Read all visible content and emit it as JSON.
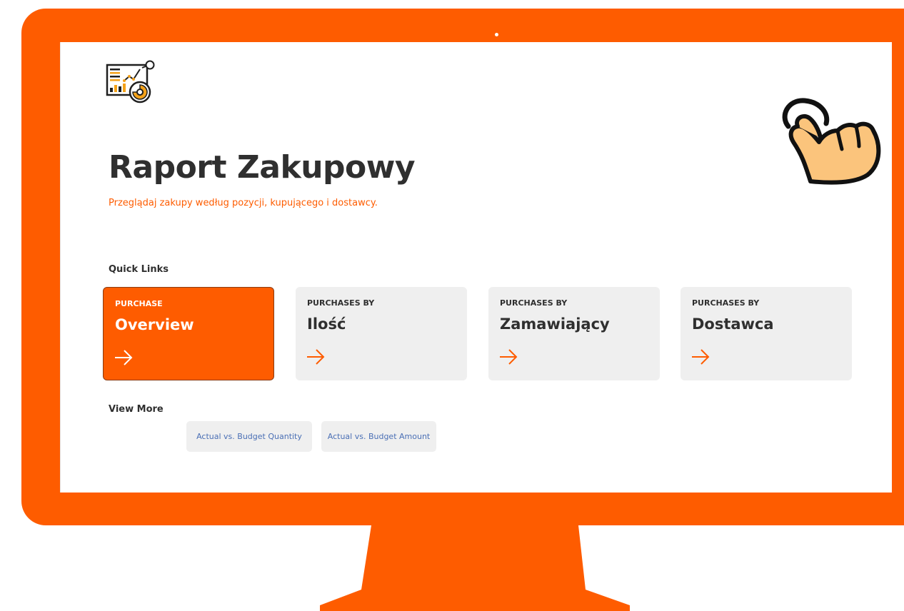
{
  "header": {
    "title": "Raport Zakupowy",
    "subtitle": "Przeglądaj zakupy według pozycji, kupującego i dostawcy."
  },
  "quick_links": {
    "label": "Quick Links",
    "cards": [
      {
        "kicker": "PURCHASE",
        "title": "Overview",
        "active": true
      },
      {
        "kicker": "PURCHASES BY",
        "title": "Ilość",
        "active": false
      },
      {
        "kicker": "PURCHASES BY",
        "title": "Zamawiający",
        "active": false
      },
      {
        "kicker": "PURCHASES BY",
        "title": "Dostawca",
        "active": false
      }
    ]
  },
  "view_more": {
    "label": "View More",
    "links": [
      "Actual vs. Budget Quantity",
      "Actual vs. Budget Amount"
    ]
  },
  "icons": {
    "logo": "report-analytics-icon",
    "pointer": "tap-hand-icon",
    "card_arrow": "arrow-right-icon"
  },
  "colors": {
    "accent": "#fe5c00",
    "card_bg": "#efefef",
    "text": "#2f2f2f",
    "link": "#4a6fb5"
  }
}
